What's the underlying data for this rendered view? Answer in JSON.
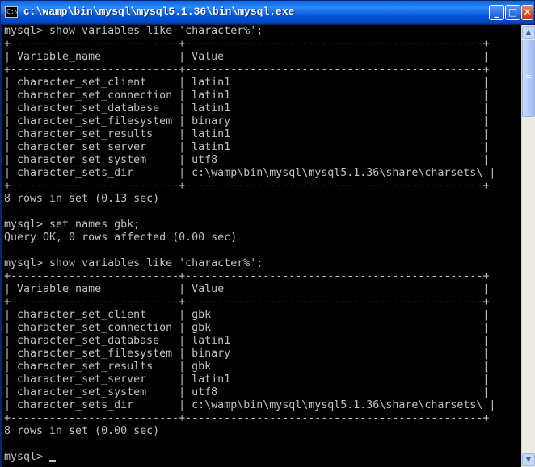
{
  "window": {
    "title": "c:\\wamp\\bin\\mysql\\mysql5.1.36\\bin\\mysql.exe",
    "icon": "console-app-icon",
    "icon_text": "C:\\"
  },
  "buttons": {
    "minimize": "_",
    "maximize": "□",
    "close": "✕"
  },
  "console": {
    "lines": [
      "mysql> show variables like 'character%';",
      "+--------------------------+----------------------------------------------+",
      "| Variable_name            | Value                                        |",
      "+--------------------------+----------------------------------------------+",
      "| character_set_client     | latin1                                       |",
      "| character_set_connection | latin1                                       |",
      "| character_set_database   | latin1                                       |",
      "| character_set_filesystem | binary                                       |",
      "| character_set_results    | latin1                                       |",
      "| character_set_server     | latin1                                       |",
      "| character_set_system     | utf8                                         |",
      "| character_sets_dir       | c:\\wamp\\bin\\mysql\\mysql5.1.36\\share\\charsets\\ |",
      "+--------------------------+----------------------------------------------+",
      "8 rows in set (0.13 sec)",
      "",
      "mysql> set names gbk;",
      "Query OK, 0 rows affected (0.00 sec)",
      "",
      "mysql> show variables like 'character%';",
      "+--------------------------+----------------------------------------------+",
      "| Variable_name            | Value                                        |",
      "+--------------------------+----------------------------------------------+",
      "| character_set_client     | gbk                                          |",
      "| character_set_connection | gbk                                          |",
      "| character_set_database   | latin1                                       |",
      "| character_set_filesystem | binary                                       |",
      "| character_set_results    | gbk                                          |",
      "| character_set_server     | latin1                                       |",
      "| character_set_system     | utf8                                         |",
      "| character_sets_dir       | c:\\wamp\\bin\\mysql\\mysql5.1.36\\share\\charsets\\ |",
      "+--------------------------+----------------------------------------------+",
      "8 rows in set (0.00 sec)",
      "",
      "mysql> "
    ]
  },
  "colors": {
    "console_bg": "#000000",
    "console_fg": "#c0c0c0",
    "titlebar": "#0a5ce0"
  }
}
